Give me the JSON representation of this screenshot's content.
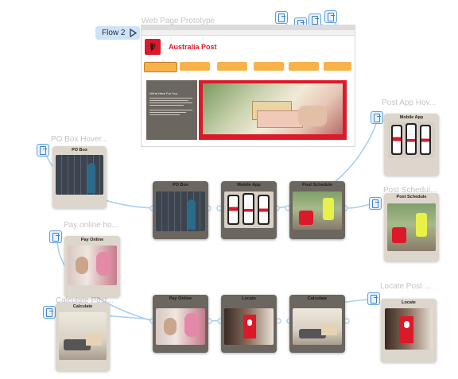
{
  "prototype": {
    "title": "Web Page Prototype",
    "flow_label": "Flow 2",
    "brand_name": "Australia Post",
    "nav_items": [
      "",
      "",
      "",
      "",
      "",
      ""
    ],
    "hero_heading": "We're Here For You.",
    "hero_body": "",
    "top_icon_labels": [
      "",
      "",
      "",
      ""
    ]
  },
  "annotations": {
    "post_app_hover": "Post App Hov...",
    "po_box_hover": "PO Box Hover...",
    "post_schedule": "Post Schedul...",
    "pay_online_hover": "Pay online ho...",
    "calculate": "Calculate Post...",
    "locate": "Locate Post ..."
  },
  "cards": {
    "mobile_app_hover": {
      "title": "Mobile App",
      "link": ""
    },
    "po_box_hover": {
      "title": "PO Box",
      "link": ""
    },
    "post_schedule_hover": {
      "title": "Post Schedule",
      "link": ""
    },
    "pay_online_hover": {
      "title": "Pay Online",
      "link": ""
    },
    "calculate_hover": {
      "title": "Calculate",
      "link": ""
    },
    "locate_hover": {
      "title": "Locate",
      "link": ""
    },
    "po_box": {
      "title": "PO Box",
      "caption": ""
    },
    "mobile_app": {
      "title": "Mobile App",
      "caption": ""
    },
    "post_schedule": {
      "title": "Post Schedule",
      "caption": ""
    },
    "pay_online": {
      "title": "Pay Online",
      "caption": ""
    },
    "locate": {
      "title": "Locate",
      "caption": ""
    },
    "calculate": {
      "title": "Calculate",
      "caption": ""
    }
  },
  "colors": {
    "accent_red": "#dc1928",
    "nav_orange": "#f7b34a",
    "connector_blue": "#a9cff0",
    "card_dark": "#6b6660",
    "card_light": "#ddd6cc"
  }
}
